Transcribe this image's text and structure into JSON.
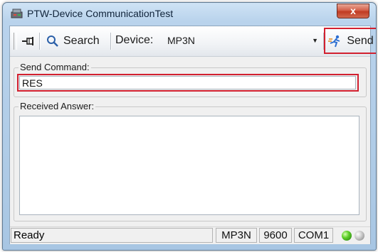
{
  "window": {
    "title": "PTW-Device CommunicationTest",
    "close_label": "x"
  },
  "toolbar": {
    "search_label": "Search",
    "device_label": "Device:",
    "device_value": "MP3N",
    "send_label": "Send"
  },
  "send_command": {
    "legend": "Send Command:",
    "value": "RES"
  },
  "received_answer": {
    "legend": "Received Answer:",
    "value": ""
  },
  "statusbar": {
    "status": "Ready",
    "device": "MP3N",
    "baud": "9600",
    "port": "COM1"
  },
  "colors": {
    "highlight": "#d2202f",
    "led_on": "#5fcf2a",
    "led_off": "#c8c8c8"
  },
  "icons": {
    "app": "app-device-icon",
    "pin": "pin-icon",
    "search": "search-icon",
    "send": "send-runner-icon",
    "dropdown": "chevron-down-icon"
  }
}
